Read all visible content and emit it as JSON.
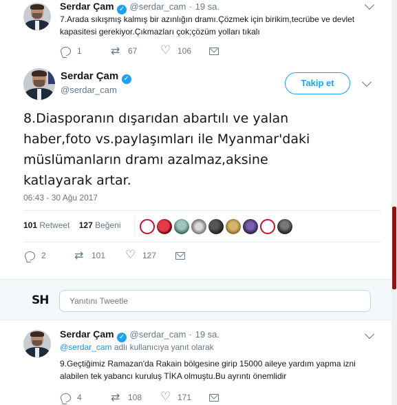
{
  "tweet_prev": {
    "name": "Serdar Çam",
    "handle": "@serdar_cam",
    "time": "19 sa.",
    "separator": "·",
    "text_line1": "7.Arada sıkışmış kalmış bir azınlığın dramı.Çözmek için birikim,tecrübe ve devlet",
    "text_line2": "kapasitesi gerekiyor.Çıkmazları çok;çözüm yolları tıkalı",
    "replies": "1",
    "retweets": "67",
    "likes": "106"
  },
  "tweet_main": {
    "name": "Serdar Çam",
    "handle": "@serdar_cam",
    "follow_label": "Takip et",
    "text_line1": "8.Diasporanın dışarıdan abartılı ve yalan",
    "text_line2": "haber,foto vs.paylaşımları ile Myanmar'daki",
    "text_line3": "müslümanların dramı azalmaz,aksine",
    "text_line4": "katlayarak artar.",
    "timestamp": "06:43 - 30 Ağu 2017",
    "retweet_count": "101",
    "retweet_label": "Retweet",
    "like_count": "127",
    "like_label": "Beğeni",
    "replies": "2",
    "retweets": "101",
    "likes": "127"
  },
  "reply_box": {
    "logo_text": "SH",
    "placeholder": "Yanıtını Tweetle"
  },
  "tweet_next": {
    "name": "Serdar Çam",
    "handle": "@serdar_cam",
    "time": "19 sa.",
    "separator": "·",
    "reply_to_handle": "@serdar_cam",
    "reply_to_suffix": " adlı kullanıcıya yanıt olarak",
    "text_line1": "9.Geçtiğimiz Ramazan'da Rakain bölgesine girip 15000 aileye yardım yapma izni",
    "text_line2": "alabilen tek yabancı kuruluş TİKA olmuştu.Bu ayrıntı önemlidir",
    "replies": "4",
    "retweets": "108",
    "likes": "171"
  },
  "colors": {
    "accent": "#1da1f2",
    "link": "#1b95e0",
    "muted": "#657786",
    "text": "#14171a",
    "divider": "#e6ecf0",
    "reply_area_bg": "#f5f8fa"
  },
  "icons": [
    "reply-icon",
    "retweet-icon",
    "like-icon",
    "direct-message-icon",
    "verified-badge-icon",
    "chevron-down-icon"
  ]
}
